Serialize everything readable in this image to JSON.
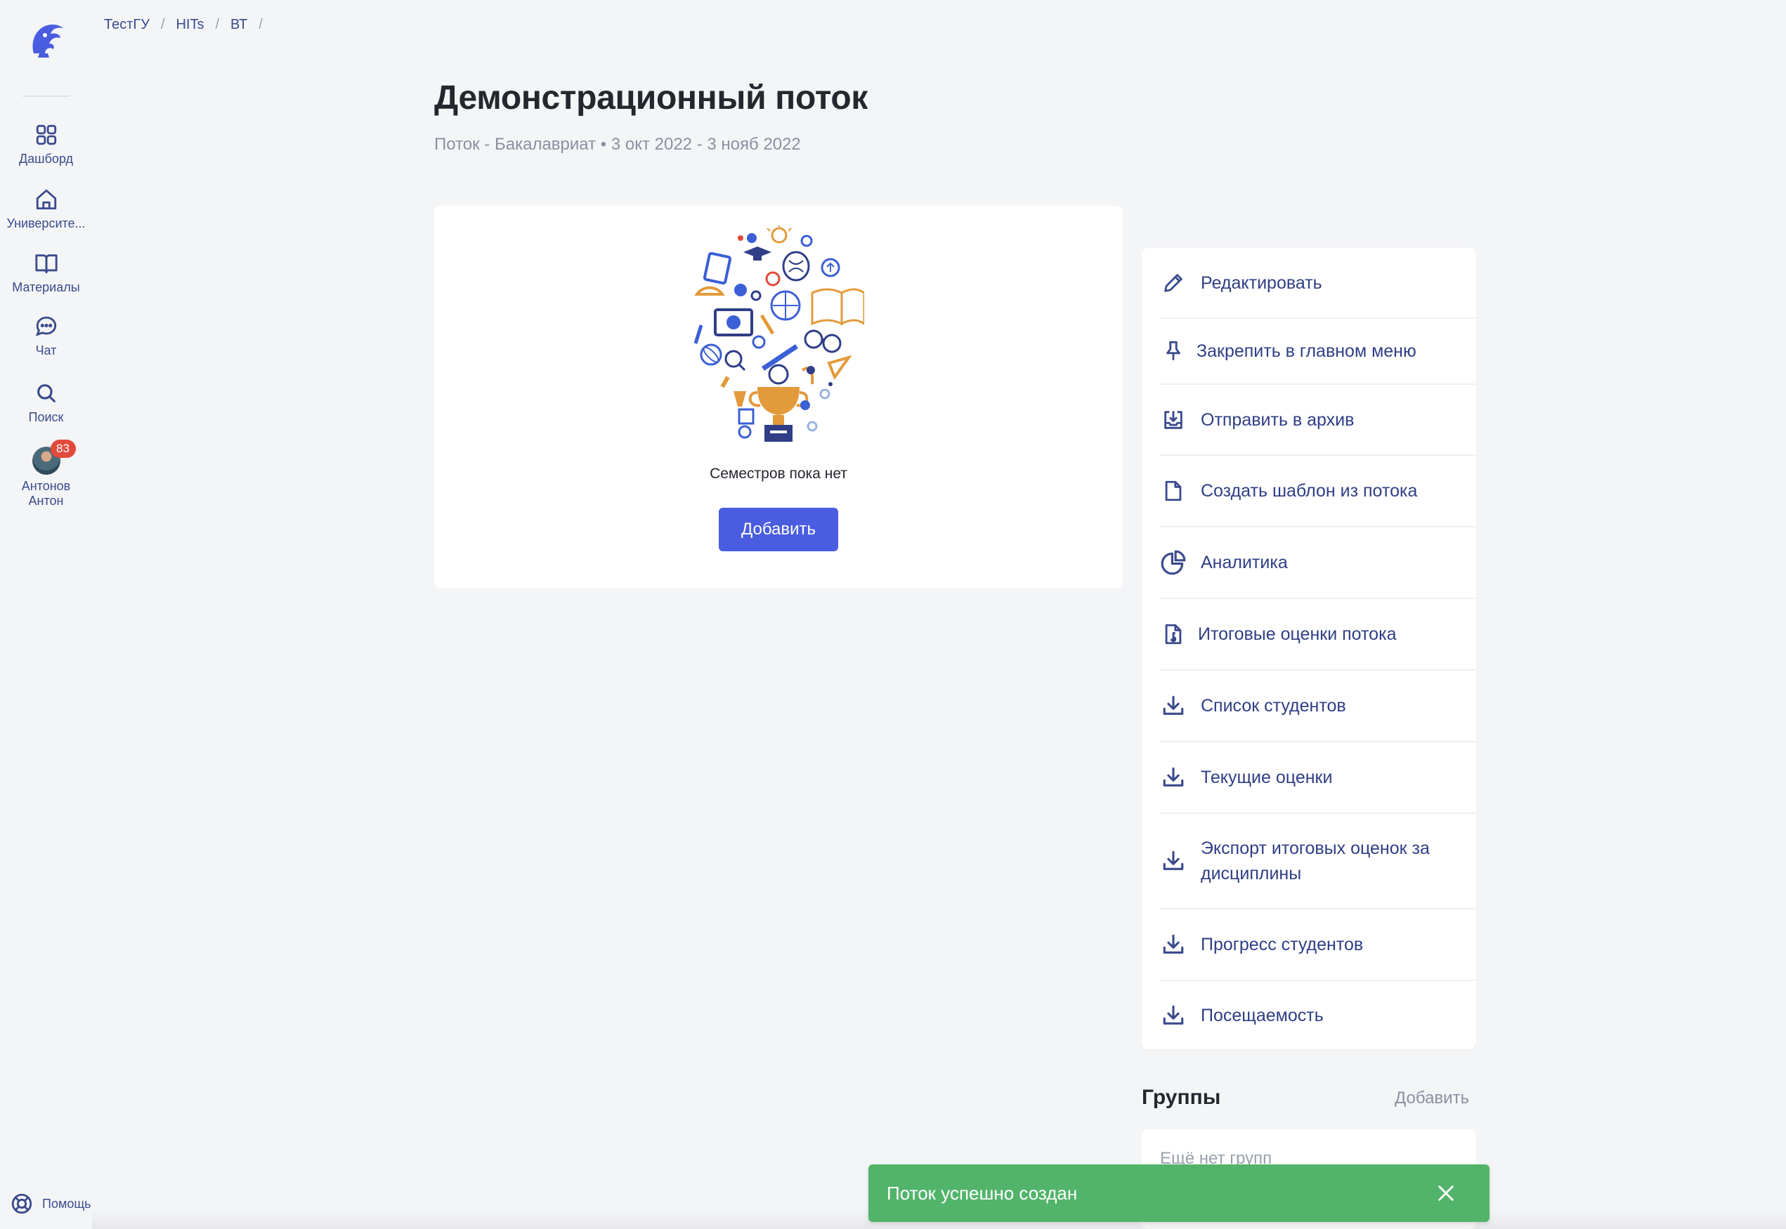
{
  "sidebar": {
    "items": [
      {
        "label": "Дашборд",
        "icon": "dashboard-icon"
      },
      {
        "label": "Университе...",
        "icon": "home-icon"
      },
      {
        "label": "Материалы",
        "icon": "book-icon"
      },
      {
        "label": "Чат",
        "icon": "chat-icon"
      },
      {
        "label": "Поиск",
        "icon": "search-icon"
      }
    ],
    "profile": {
      "name_line1": "Антонов",
      "name_line2": "Антон",
      "badge": "83"
    },
    "help_label": "Помощь"
  },
  "breadcrumb": [
    "ТестГУ",
    "HITs",
    "ВТ"
  ],
  "header": {
    "title": "Демонстрационный поток",
    "subtitle": "Поток - Бакалавриат • 3 окт 2022 - 3 нояб 2022"
  },
  "semesters": {
    "empty_text": "Семестров пока нет",
    "add_label": "Добавить"
  },
  "actions": [
    {
      "label": "Редактировать",
      "icon": "pencil-icon"
    },
    {
      "label": "Закрепить в главном меню",
      "icon": "pin-icon"
    },
    {
      "label": "Отправить в архив",
      "icon": "archive-icon"
    },
    {
      "label": "Создать шаблон из потока",
      "icon": "document-icon"
    },
    {
      "label": "Аналитика",
      "icon": "pie-chart-icon"
    },
    {
      "label": "Итоговые оценки потока",
      "icon": "grades-file-icon"
    },
    {
      "label": "Список студентов",
      "icon": "download-icon"
    },
    {
      "label": "Текущие оценки",
      "icon": "download-icon"
    },
    {
      "label": "Экспорт итоговых оценок за дисциплины",
      "icon": "download-icon"
    },
    {
      "label": "Прогресс студентов",
      "icon": "download-icon"
    },
    {
      "label": "Посещаемость",
      "icon": "download-icon"
    }
  ],
  "groups": {
    "title": "Группы",
    "add_label": "Добавить",
    "empty_text": "Ещё нет групп"
  },
  "toast": {
    "message": "Поток успешно создан"
  },
  "colors": {
    "accent": "#4a5de0",
    "nav_text": "#3a4a8c",
    "toast_bg": "#52b46b",
    "badge_bg": "#e24a3b",
    "page_bg": "#f4f5f7"
  }
}
